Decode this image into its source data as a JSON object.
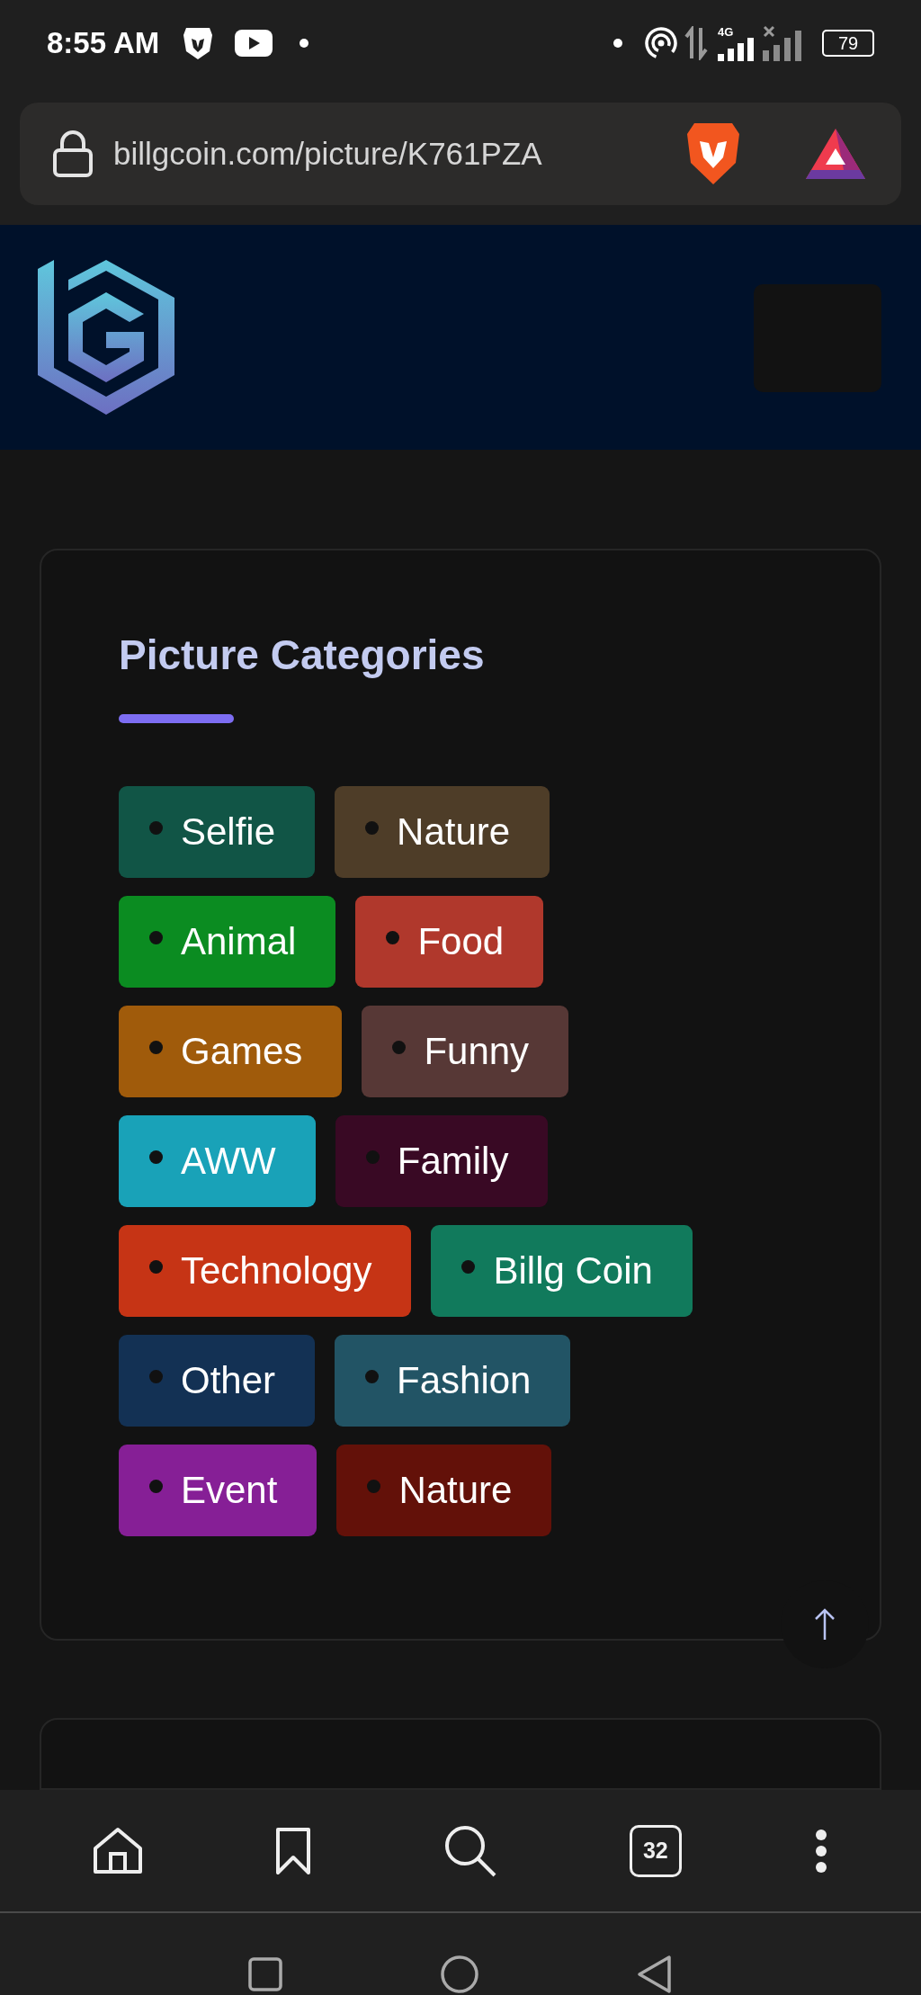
{
  "status_bar": {
    "time": "8:55 AM",
    "network": "4G",
    "battery": "79"
  },
  "address_bar": {
    "url": "billgcoin.com/picture/K761PZA"
  },
  "categories": {
    "title": "Picture Categories",
    "tags": [
      {
        "label": "Selfie",
        "color": "#115546"
      },
      {
        "label": "Nature",
        "color": "#4e3d28"
      },
      {
        "label": "Animal",
        "color": "#0b8c21"
      },
      {
        "label": "Food",
        "color": "#b0382c"
      },
      {
        "label": "Games",
        "color": "#a05b0b"
      },
      {
        "label": "Funny",
        "color": "#573836"
      },
      {
        "label": "AWW",
        "color": "#19a2b8"
      },
      {
        "label": "Family",
        "color": "#390924"
      },
      {
        "label": "Technology",
        "color": "#c63415"
      },
      {
        "label": "Billg Coin",
        "color": "#117a5c"
      },
      {
        "label": "Other",
        "color": "#133154"
      },
      {
        "label": "Fashion",
        "color": "#225465"
      },
      {
        "label": "Event",
        "color": "#861f96"
      },
      {
        "label": "Nature",
        "color": "#631109"
      }
    ]
  },
  "browser_toolbar": {
    "tab_count": "32"
  }
}
